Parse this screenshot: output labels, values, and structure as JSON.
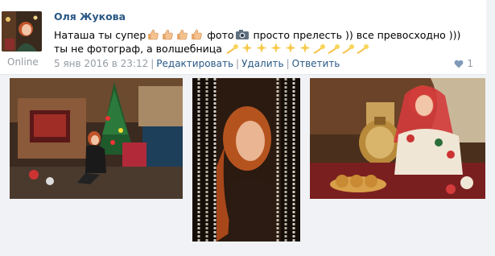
{
  "post": {
    "author": "Оля Жукова",
    "status": "Online",
    "text_part1": "Наташа ты супер",
    "text_part2": "фото",
    "text_part3": "просто прелесть )) все превосходно ))) ты не фотограф, а волшебница",
    "date": "5 янв 2016 в 23:12",
    "actions": {
      "edit": "Редактировать",
      "delete": "Удалить",
      "reply": "Ответить"
    },
    "like_count": "1"
  },
  "icons": {
    "thumbs_up": "thumbs-up-icon",
    "camera": "camera-icon",
    "sparkles": "sparkles-icon",
    "comet": "comet-icon",
    "heart": "heart-icon"
  },
  "colors": {
    "link": "#2a5885",
    "muted": "#939ba3",
    "heart": "#7f9ab8"
  }
}
